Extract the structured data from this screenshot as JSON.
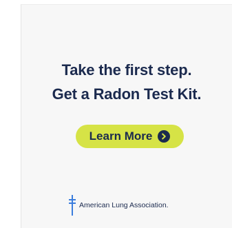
{
  "ad": {
    "headline_line1": "Take the first step.",
    "headline_line2": "Get a Radon Test Kit.",
    "cta_label": "Learn More",
    "cta_icon": "arrow-right-circle-icon",
    "logo_icon": "double-barred-cross-icon",
    "logo_text": "American Lung Association."
  },
  "colors": {
    "navy": "#1b2a4e",
    "cta_background": "#d6e346",
    "logo_cross": "#3b7ddd",
    "background": "#f7f7f7"
  }
}
